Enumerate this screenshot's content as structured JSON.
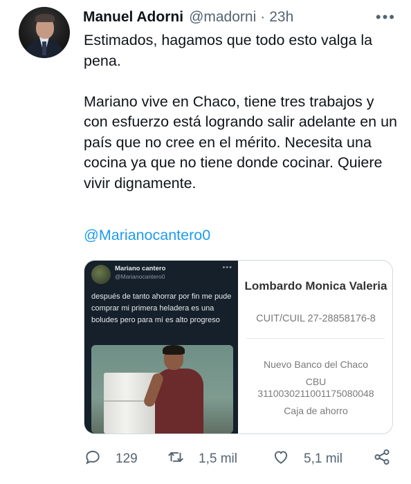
{
  "author": {
    "name": "Manuel Adorni",
    "handle": "@madorni",
    "separator": "·",
    "time": "23h",
    "more": "•••"
  },
  "tweet": {
    "text": "Estimados, hagamos que todo esto valga la pena.\n\nMariano vive en Chaco, tiene tres trabajos y con esfuerzo está logrando salir adelante en un país que no cree en el mérito. Necesita una cocina ya que no tiene donde cocinar. Quiere vivir dignamente.",
    "mention": "@Marianocantero0"
  },
  "media": {
    "embedded_tweet": {
      "name": "Mariano cantero",
      "handle": "@Marianocantero0",
      "more": "•••",
      "text": "después de tanto ahorrar por fin me pude comprar mi primera heladera es una boludes pero para mí es alto progreso"
    },
    "bank_details": {
      "holder": "Lombardo Monica Valeria",
      "cuit": "CUIT/CUIL 27-28858176-8",
      "bank": "Nuevo Banco del Chaco",
      "cbu_label": "CBU",
      "cbu": "3110030211001175080048",
      "account_type": "Caja de ahorro"
    }
  },
  "actions": {
    "replies": "129",
    "retweets": "1,5 mil",
    "likes": "5,1 mil",
    "icons": [
      "reply-icon",
      "retweet-icon",
      "like-icon",
      "share-icon"
    ]
  },
  "colors": {
    "link": "#1d9bf0",
    "secondary_text": "#536471",
    "embedded_bg": "#15202b"
  }
}
